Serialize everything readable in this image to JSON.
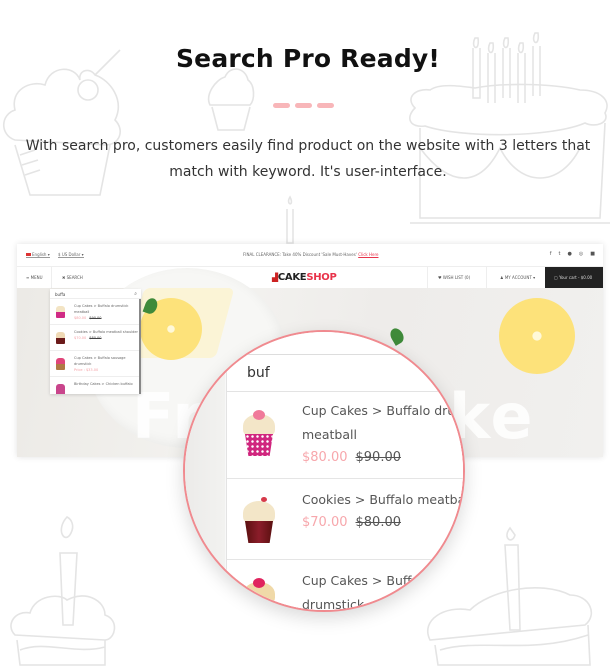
{
  "section": {
    "title": "Search Pro Ready!",
    "description": "With search pro, customers easily find product on the website with 3 letters that match with keyword. It's user-interface.",
    "accent_color": "#f8b6b9"
  },
  "site": {
    "topbar": {
      "language": "English",
      "currency": "$ US Dollar",
      "promo_text": "FINAL CLEARANCE: Take 40% Discount 'Sale Must-Haves'",
      "promo_link": "Click Here",
      "socials": [
        "facebook-icon",
        "twitter-icon",
        "pinterest-icon",
        "instagram-icon",
        "youtube-icon"
      ]
    },
    "nav": {
      "menu_label": "MENU",
      "search_label": "SEARCH",
      "logo_part1": "CAKE",
      "logo_part2": "SHOP",
      "wishlist_label": "WISH LIST (0)",
      "account_label": "MY ACCOUNT",
      "cart_label": "Your cart - $0.00"
    },
    "hero_text": "Fresh Cake",
    "mini_search": {
      "query": "buffa",
      "results": [
        {
          "name": "Cup Cakes > Buffalo drumstick meatball",
          "price": "$80.00",
          "old_price": "$90.00"
        },
        {
          "name": "Cookies > Buffalo meatball shoulder",
          "price": "$70.00",
          "old_price": "$80.00"
        },
        {
          "name": "Cup Cakes > Buffalo sausage drumstick",
          "price": "Price : $33.00",
          "old_price": ""
        },
        {
          "name": "Birthday Cakes > Chicken buffalo",
          "price": "",
          "old_price": ""
        }
      ]
    }
  },
  "magnifier": {
    "query": "buf",
    "results": [
      {
        "name_line1": "Cup Cakes > Buffalo drumst",
        "name_line2": "meatball",
        "price": "$80.00",
        "old_price": "$90.00"
      },
      {
        "name_line1": "Cookies > Buffalo meatball sh",
        "name_line2": "",
        "price": "$70.00",
        "old_price": "$80.00"
      },
      {
        "name_line1": "Cup Cakes > Buffalo",
        "name_line2": "drumstick",
        "price": "",
        "old_price": ""
      }
    ]
  }
}
